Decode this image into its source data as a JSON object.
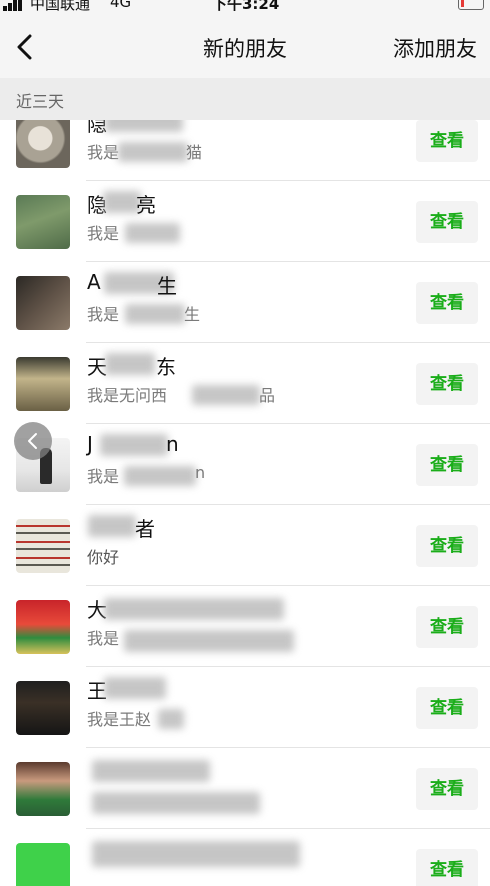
{
  "status_bar": {
    "carrier": "中国联通",
    "network": "4G",
    "time": "下午3:24",
    "battery_level": 0.12
  },
  "nav": {
    "back_icon": "chevron-left-icon",
    "title": "新的朋友",
    "action": "添加朋友"
  },
  "section": {
    "label": "近三天"
  },
  "rows": [
    {
      "name": "隐",
      "message": "我是",
      "message_tail": "猫",
      "button": "查看"
    },
    {
      "name": "隐",
      "name_tail": "亮",
      "message": "我是",
      "button": "查看"
    },
    {
      "name": "A",
      "name_tail": "生",
      "message": "我是",
      "message_tail": "生",
      "button": "查看"
    },
    {
      "name": "天",
      "name_tail": "东",
      "message": "我是无问西",
      "message_tail": "品",
      "button": "查看"
    },
    {
      "name": "J",
      "name_tail": "n",
      "message": "我是",
      "message_tail": "n",
      "button": "查看"
    },
    {
      "name": "",
      "name_tail": "者",
      "message": "你好",
      "button": "查看"
    },
    {
      "name": "大",
      "message": "我是",
      "button": "查看"
    },
    {
      "name": "王",
      "message": "我是王赵",
      "button": "查看"
    },
    {
      "name": "",
      "message": "",
      "button": "查看"
    },
    {
      "name": "",
      "message": "",
      "button": "查看"
    }
  ],
  "colors": {
    "accent": "#1aad19",
    "header_bg": "#f5f5f5",
    "section_bg": "#ececec"
  }
}
